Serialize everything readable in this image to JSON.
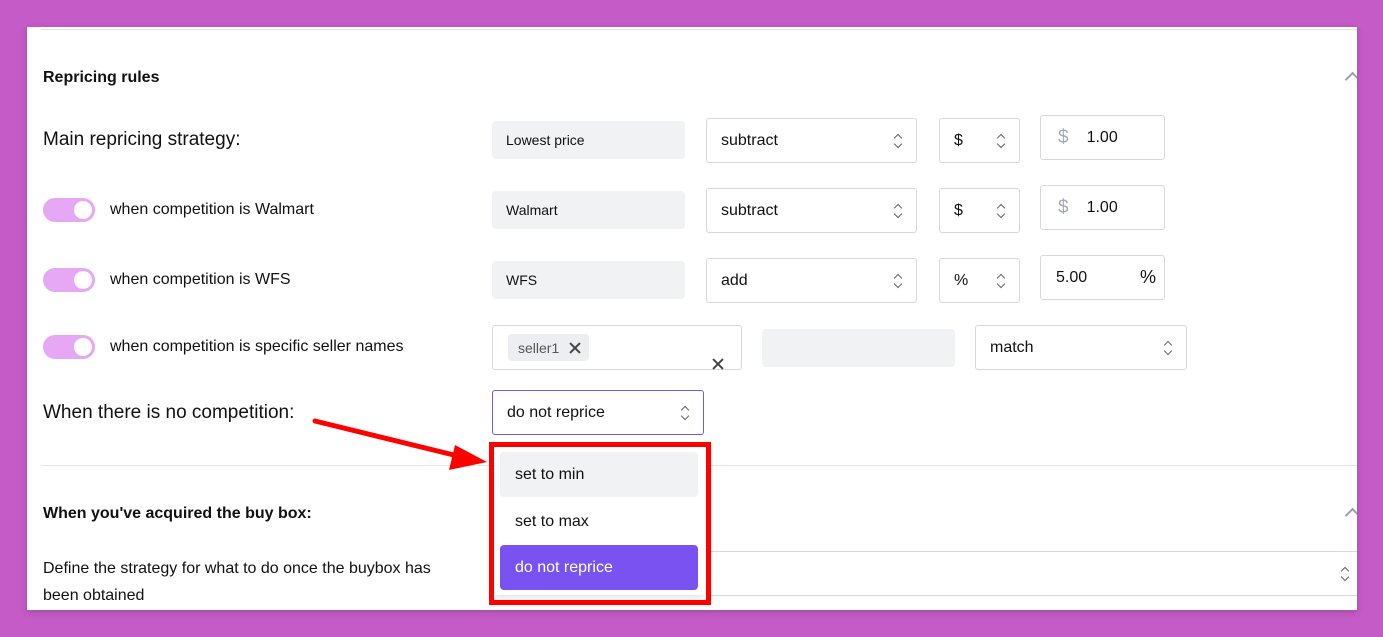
{
  "repricing": {
    "title": "Repricing rules",
    "main": {
      "label": "Main repricing strategy:",
      "source": "Lowest price",
      "operation": "subtract",
      "unit": "$",
      "prefix": "$",
      "amount": "1.00"
    },
    "rules": [
      {
        "label": "when competition is Walmart",
        "source": "Walmart",
        "operation": "subtract",
        "unit": "$",
        "prefix": "$",
        "amount": "1.00",
        "enabled": true
      },
      {
        "label": "when competition is WFS",
        "source": "WFS",
        "operation": "add",
        "unit": "%",
        "suffix": "%",
        "amount": "5.00",
        "enabled": true
      }
    ],
    "sellers": {
      "label": "when competition is specific seller names",
      "tag": "seller1",
      "action": "match",
      "enabled": true
    },
    "no_competition": {
      "label": "When there is no competition:",
      "selected": "do not reprice",
      "options": [
        "set to min",
        "set to max",
        "do not reprice"
      ]
    }
  },
  "buybox": {
    "title": "When you've acquired the buy box:",
    "description_line1": "Define the strategy for what to do once the buybox has",
    "description_line2": "been obtained"
  },
  "colors": {
    "background": "#c45bc6",
    "toggle": "#e6a8f5",
    "selected_option": "#7b52f2",
    "highlight_box": "#ff0000",
    "arrow": "#ff0000"
  }
}
